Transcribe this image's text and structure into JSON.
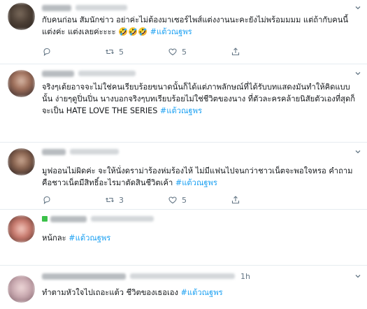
{
  "tweets": [
    {
      "time": "",
      "text": "กับคนก่อน สัมนักข่าว อย่าค่ะไม่ต้องมาเซอร์ไพส์แต่งงานนะคะยังไม่พร้อมมมม แต่ถ้ากับคนนี้ แต่งค่ะ แต่งเลยค่ะะะะ",
      "emoji": "🤣🤣🤣",
      "hashtag": "#แต้วณฐพร",
      "reply_count": "",
      "retweet_count": "5",
      "like_count": "5"
    },
    {
      "time": "",
      "text": "จริงๆเต้ยอาจจะไม่ใช่คนเรียบร้อยขนาดนั้นก็ได้แต่ภาพลักษณ์ที่ได้รับบทแสดงมันทำให้คิดแบบนั้น ง่ายๆดูปิ่นปิ่น นางบอกจริงๆบทเรียบร้อยไม่ใช่ชีวิตของนาง ที่ตัวละครคล้ายนิสัยตัวเองที่สุดก็จะเป็น HATE LOVE THE SERIES",
      "hashtag": "#แต้วณฐพร",
      "reply_count": "",
      "retweet_count": "",
      "like_count": ""
    },
    {
      "time": "",
      "text": "มูฟออนไม่ผิดค่ะ จะให้นั่งดราม่าร้องห่มร้องไห้ ไม่มีแฟนไปจนกว่าชาวเน็ตจะพอใจหรอ คำถามคือชาวเน็ตมีสิทธิ์อะไรมาตัดสินชีวิตเค้า",
      "hashtag": "#แต้วณฐพร",
      "reply_count": "",
      "retweet_count": "3",
      "like_count": "5"
    },
    {
      "time": "",
      "text": "หน้กละ",
      "hashtag": "#แต้วณฐพร",
      "reply_count": "",
      "retweet_count": "",
      "like_count": ""
    },
    {
      "time": "1h",
      "text": "ทำตามหัวใจไปเถอะแต้ว ชีวิตของเธอเอง",
      "hashtag": "#แต้วณฐพร",
      "reply_count": "",
      "retweet_count": "",
      "like_count": ""
    }
  ],
  "icons": {
    "reply": "reply-icon",
    "retweet": "retweet-icon",
    "like": "heart-icon",
    "share": "share-icon",
    "caret": "chevron-down-icon"
  },
  "colors": {
    "hashtag": "#1da1f2",
    "muted": "#657786",
    "divider": "#e6ecf0"
  }
}
